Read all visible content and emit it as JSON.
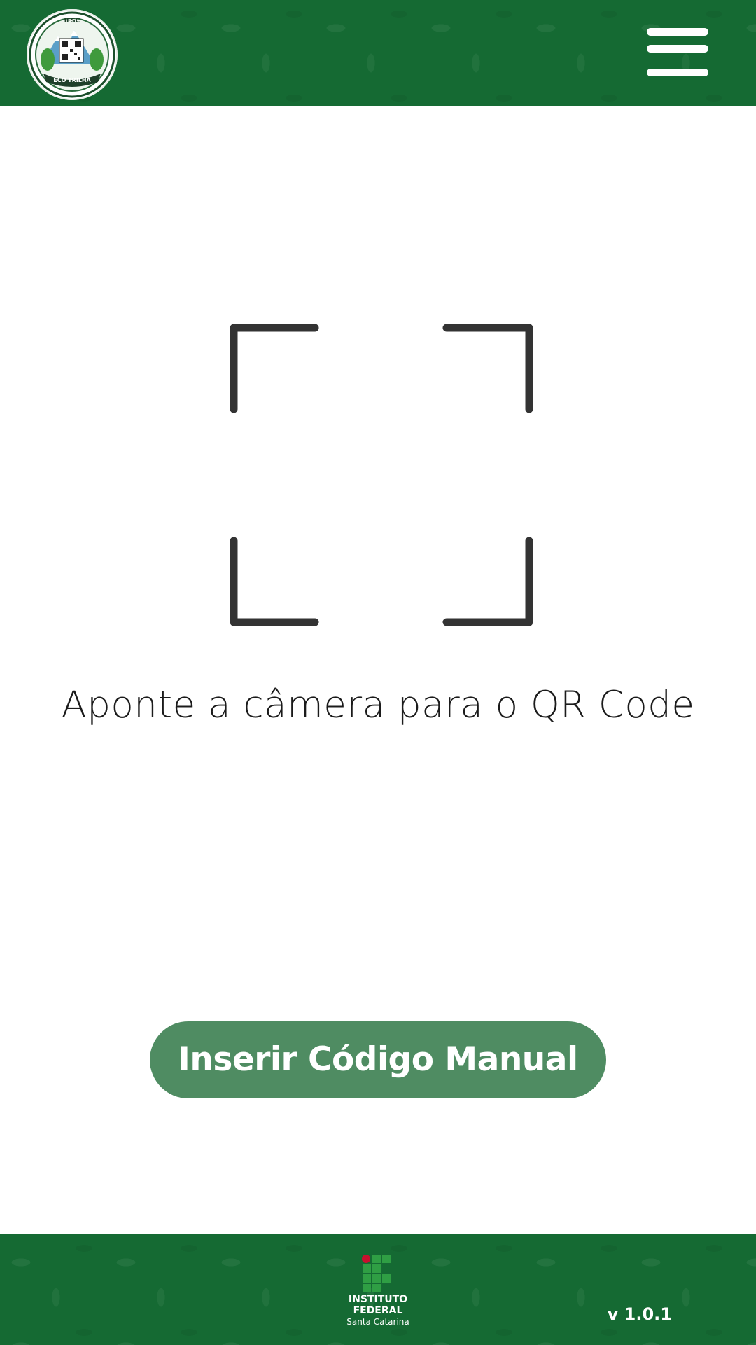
{
  "header": {
    "logo_alt": "IFSC ECO TRILHA",
    "logo_top_text": "IFSC",
    "logo_banner_text": "ECO TRILHA"
  },
  "scanner": {
    "instruction": "Aponte a câmera para o QR Code"
  },
  "actions": {
    "manual_code_label": "Inserir Código Manual"
  },
  "footer": {
    "institution_line1": "INSTITUTO",
    "institution_line2": "FEDERAL",
    "institution_line3": "Santa Catarina",
    "version": "v 1.0.1"
  },
  "colors": {
    "header_green": "#156a33",
    "button_green": "#4f8c62",
    "frame_corner": "#333333",
    "if_red": "#c8102e",
    "if_green": "#2f9e44"
  },
  "icons": {
    "menu": "hamburger-menu-icon",
    "scanner": "qr-scan-frame-icon"
  }
}
